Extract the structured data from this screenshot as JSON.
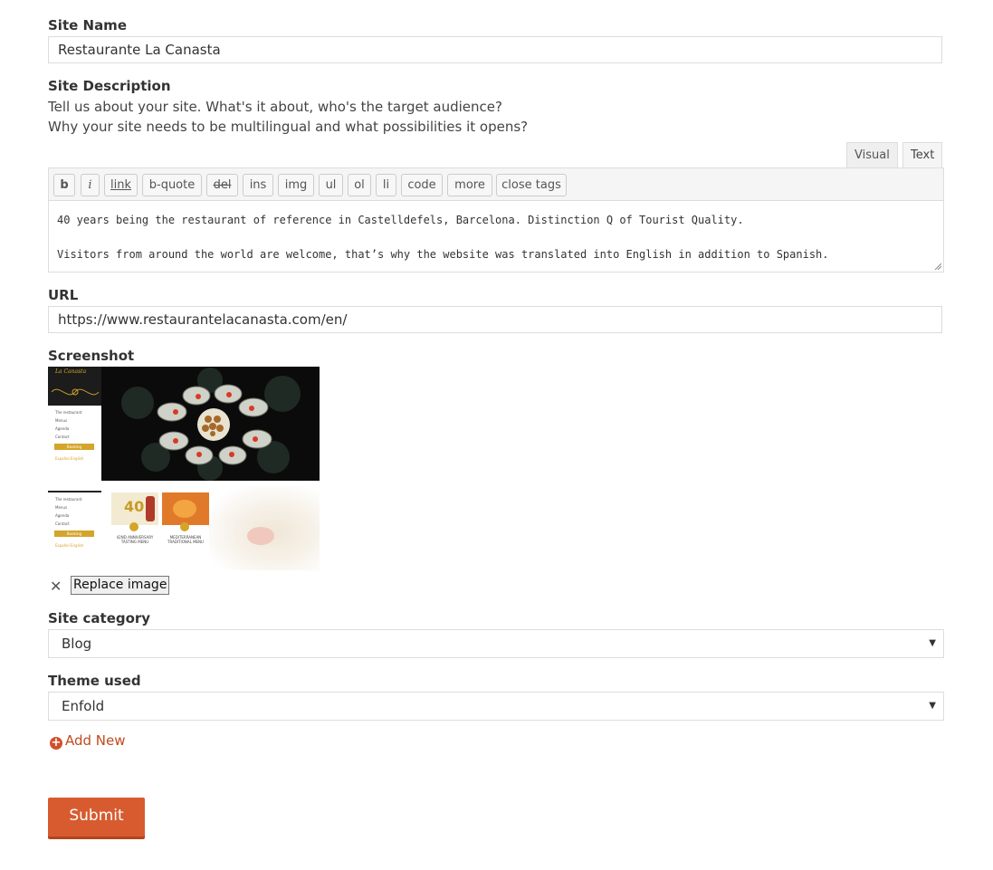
{
  "site_name": {
    "label": "Site Name",
    "value": "Restaurante La Canasta"
  },
  "site_description": {
    "label": "Site Description",
    "help_line1": "Tell us about your site. What's it about, who's the target audience?",
    "help_line2": "Why your site needs to be multilingual and what possibilities it opens?",
    "tabs": {
      "visual": "Visual",
      "text": "Text"
    },
    "toolbar": [
      "b",
      "i",
      "link",
      "b-quote",
      "del",
      "ins",
      "img",
      "ul",
      "ol",
      "li",
      "code",
      "more",
      "close tags"
    ],
    "content_line1": "40 years being the restaurant of reference in Castelldefels, Barcelona. Distinction Q of Tourist Quality.",
    "content_line2": "Visitors from around the world are welcome, that’s why the website was translated into English in addition to Spanish."
  },
  "url": {
    "label": "URL",
    "value": "https://www.restaurantelacanasta.com/en/"
  },
  "screenshot": {
    "label": "Screenshot",
    "remove_icon": "close-icon",
    "remove_glyph": "✕",
    "replace_label": "Replace image",
    "thumb": {
      "brand": "La Canasta",
      "menu": [
        "The restaurant",
        "Menus",
        "Agenda",
        "Contact"
      ],
      "booking": "Booking",
      "lang": "Español  English",
      "card1_num": "40",
      "card1_title": "42ND ANNIVERSARY TASTING MENU",
      "card2_title": "MEDITERRANEAN TRADITIONAL MENU"
    }
  },
  "site_category": {
    "label": "Site category",
    "value": "Blog"
  },
  "theme_used": {
    "label": "Theme used",
    "value": "Enfold"
  },
  "add_new": {
    "icon": "plus-circle-icon",
    "label": "Add New"
  },
  "submit": {
    "label": "Submit"
  },
  "colors": {
    "accent": "#d85b30",
    "link": "#c04b1f",
    "gold": "#d4a52a"
  }
}
